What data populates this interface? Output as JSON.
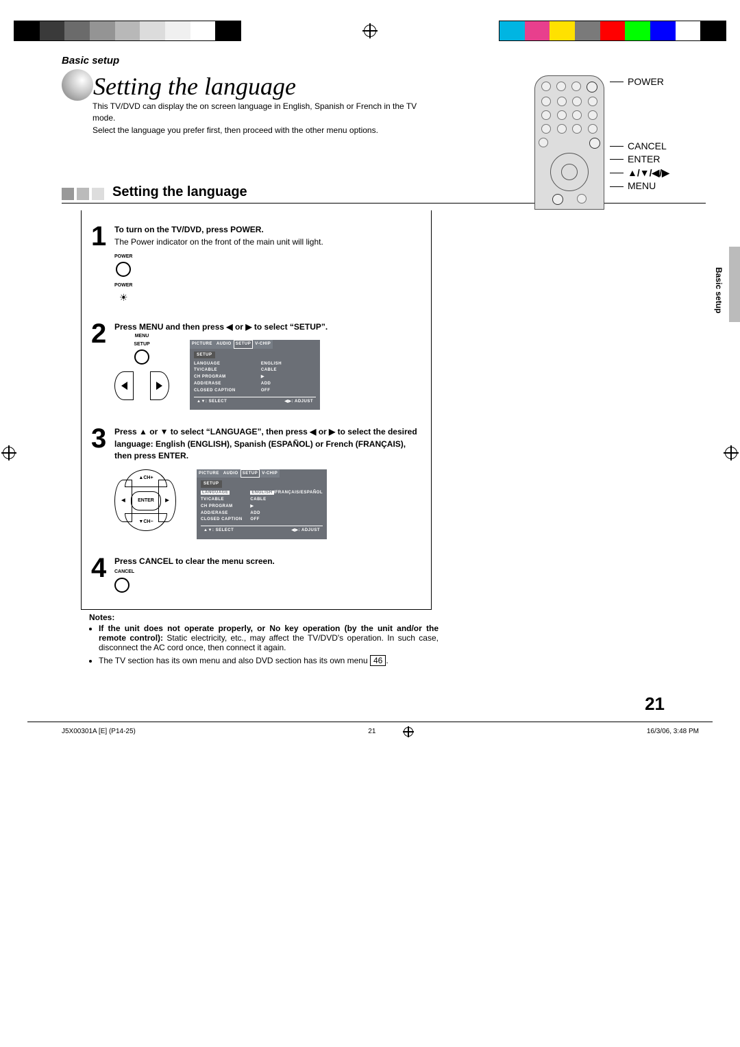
{
  "header": {
    "section_tag": "Basic setup"
  },
  "title": {
    "main": "Setting the language"
  },
  "intro": {
    "line1": "This TV/DVD can display the on screen language in English, Spanish or French in the TV mode.",
    "line2": "Select the language you prefer first, then proceed with the other menu options."
  },
  "remote_labels": {
    "power": "POWER",
    "cancel": "CANCEL",
    "enter": "ENTER",
    "arrows": "▲/▼/◀/▶",
    "menu": "MENU"
  },
  "subtitle": "Setting the language",
  "side_tab": "Basic setup",
  "steps": {
    "s1": {
      "num": "1",
      "head": "To turn on the TV/DVD, press POWER.",
      "body": "The Power indicator on the front of the main unit will light.",
      "btn_power_label": "POWER",
      "btn_power_label2": "POWER"
    },
    "s2": {
      "num": "2",
      "head_before": "Press MENU and then press ",
      "head_mid": " or ",
      "head_after": " to select “SETUP”.",
      "label_menu": "MENU",
      "label_setup": "SETUP",
      "osd": {
        "tabs": [
          "PICTURE",
          "AUDIO",
          "SETUP",
          "V-CHIP"
        ],
        "active_tab": "SETUP",
        "heading": "SETUP",
        "rows": [
          {
            "k": "LANGUAGE",
            "v": "ENGLISH"
          },
          {
            "k": "TV/CABLE",
            "v": "CABLE"
          },
          {
            "k": "CH PROGRAM",
            "v": "▶"
          },
          {
            "k": "ADD/ERASE",
            "v": "ADD"
          },
          {
            "k": "CLOSED CAPTION",
            "v": "OFF"
          }
        ],
        "foot_left_icon": "▲▼",
        "foot_left": "SELECT",
        "foot_right_icon": "◀▶",
        "foot_right": "ADJUST"
      }
    },
    "s3": {
      "num": "3",
      "head": "Press ▲ or ▼ to select “LANGUAGE”, then press ◀ or ▶ to select the desired language: English (ENGLISH), Spanish (ESPAÑOL) or French (FRANÇAIS), then press ENTER.",
      "dpad": {
        "up": "▲CH+",
        "down": "▼CH−",
        "left": "◀",
        "right": "▶",
        "mid": "ENTER"
      },
      "osd": {
        "tabs": [
          "PICTURE",
          "AUDIO",
          "SETUP",
          "V-CHIP"
        ],
        "active_tab": "SETUP",
        "heading": "SETUP",
        "rows": [
          {
            "k": "LANGUAGE",
            "v_inv": "ENGLISH",
            "v_rest": "/FRANÇAIS/ESPAÑOL"
          },
          {
            "k": "TV/CABLE",
            "v": "CABLE"
          },
          {
            "k": "CH PROGRAM",
            "v": "▶"
          },
          {
            "k": "ADD/ERASE",
            "v": "ADD"
          },
          {
            "k": "CLOSED CAPTION",
            "v": "OFF"
          }
        ],
        "foot_left_icon": "▲▼",
        "foot_left": "SELECT",
        "foot_right_icon": "◀▶",
        "foot_right": "ADJUST"
      }
    },
    "s4": {
      "num": "4",
      "head": "Press CANCEL to clear the menu screen.",
      "label_cancel": "CANCEL"
    }
  },
  "notes": {
    "heading": "Notes:",
    "n1_bold": "If the unit does not operate properly, or No key operation (by the unit and/or the remote control):",
    "n1_rest": " Static electricity, etc., may affect the TV/DVD's operation. In such case, disconnect the AC cord once, then connect it again.",
    "n2_a": "The TV section has its own menu and also DVD section has its own menu ",
    "n2_page": "46",
    "n2_b": "."
  },
  "page_number": "21",
  "footer": {
    "left": "J5X00301A [E] (P14-25)",
    "center": "21",
    "right": "16/3/06, 3:48 PM"
  },
  "reg_colors": {
    "strip1": [
      "#000",
      "#3a3a3a",
      "#6b6b6b",
      "#949494",
      "#b8b8b8",
      "#dcdcdc",
      "#f0f0f0",
      "#fff",
      "#000"
    ],
    "strip2": [
      "#00b5e2",
      "#e83f8d",
      "#ffe100",
      "#7a7a7a",
      "#ff0000",
      "#00ff00",
      "#0000ff",
      "#fff",
      "#000"
    ]
  }
}
